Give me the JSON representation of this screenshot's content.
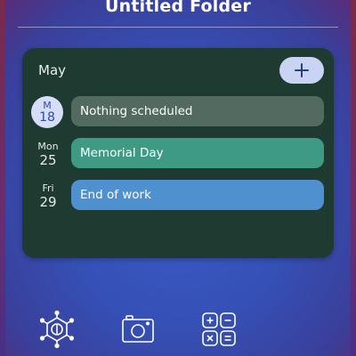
{
  "folder": {
    "title": "Untitled Folder"
  },
  "calendar_widget": {
    "month": "May",
    "add_icon": "plus-icon",
    "rows": [
      {
        "dow": "M",
        "day": "18",
        "event": "Nothing scheduled",
        "color": "#536a60",
        "is_today": true
      },
      {
        "dow": "Mon",
        "day": "25",
        "event": "Memorial Day",
        "color": "#3e9a83",
        "is_today": false
      },
      {
        "dow": "Fri",
        "day": "29",
        "event": "End of work",
        "color": "#4f90cf",
        "is_today": false
      }
    ]
  },
  "dock": {
    "icons": [
      "hexagon-network-icon",
      "camera-icon",
      "calculator-icon"
    ]
  },
  "colors": {
    "widget_bg": "#1f3a31",
    "add_button_bg": "#c9d4f4",
    "today_circle": "#d5def6",
    "background": "#3551b7"
  }
}
